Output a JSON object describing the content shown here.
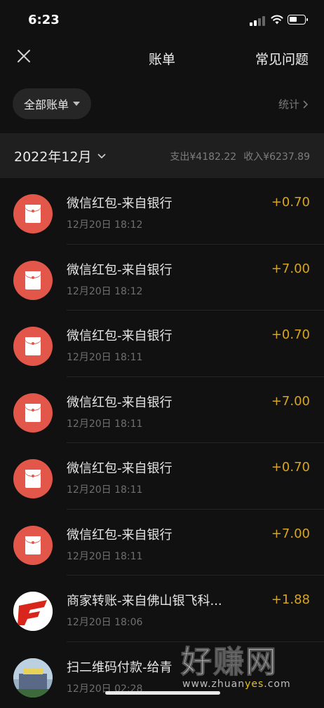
{
  "status_bar": {
    "time": "6:23"
  },
  "nav": {
    "title": "账单",
    "faq_label": "常见问题"
  },
  "filter": {
    "label": "全部账单",
    "stats_label": "统计"
  },
  "month_bar": {
    "month": "2022年12月",
    "expense": "支出¥4182.22",
    "income": "收入¥6237.89"
  },
  "transactions": [
    {
      "title": "微信红包-来自银行",
      "time": "12月20日 18:12",
      "amount": "+0.70",
      "icon": "red-packet-icon"
    },
    {
      "title": "微信红包-来自银行",
      "time": "12月20日 18:12",
      "amount": "+7.00",
      "icon": "red-packet-icon"
    },
    {
      "title": "微信红包-来自银行",
      "time": "12月20日 18:11",
      "amount": "+0.70",
      "icon": "red-packet-icon"
    },
    {
      "title": "微信红包-来自银行",
      "time": "12月20日 18:11",
      "amount": "+7.00",
      "icon": "red-packet-icon"
    },
    {
      "title": "微信红包-来自银行",
      "time": "12月20日 18:11",
      "amount": "+0.70",
      "icon": "red-packet-icon"
    },
    {
      "title": "微信红包-来自银行",
      "time": "12月20日 18:11",
      "amount": "+7.00",
      "icon": "red-packet-icon"
    },
    {
      "title": "商家转账-来自佛山银飞科...",
      "time": "12月20日 18:06",
      "amount": "+1.88",
      "icon": "merchant-logo"
    },
    {
      "title": "扫二维码付款-给青",
      "time": "12月20日 02:28",
      "amount": "",
      "icon": "merchant-photo"
    }
  ],
  "watermark": {
    "big": "好赚网",
    "url_prefix": "www.zhuan",
    "url_highlight": "yes",
    "url_suffix": ".com"
  },
  "colors": {
    "background": "#111111",
    "income_amount": "#d8a51f",
    "red_packet": "#e2574a"
  }
}
